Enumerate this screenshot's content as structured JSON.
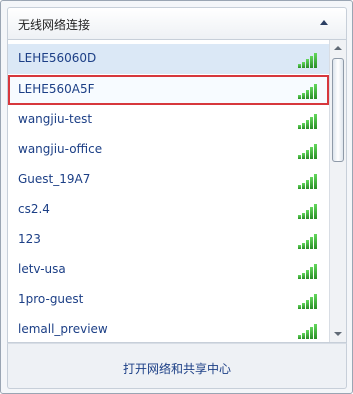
{
  "panel": {
    "title": "无线网络连接",
    "networks": [
      {
        "name": "LEHE56060D",
        "state": "connected"
      },
      {
        "name": "LEHE560A5F",
        "state": "selected"
      },
      {
        "name": "wangjiu-test",
        "state": "normal"
      },
      {
        "name": "wangjiu-office",
        "state": "normal"
      },
      {
        "name": "Guest_19A7",
        "state": "normal"
      },
      {
        "name": "cs2.4",
        "state": "normal"
      },
      {
        "name": "123",
        "state": "normal"
      },
      {
        "name": "letv-usa",
        "state": "normal"
      },
      {
        "name": "1pro-guest",
        "state": "normal"
      },
      {
        "name": "lemall_preview",
        "state": "normal"
      }
    ],
    "footer_link": "打开网络和共享中心"
  },
  "colors": {
    "link_text": "#1c3f86",
    "selected_border": "#d7373c",
    "connected_bg": "#dbe8f6",
    "signal_green": "#2a8e27"
  }
}
